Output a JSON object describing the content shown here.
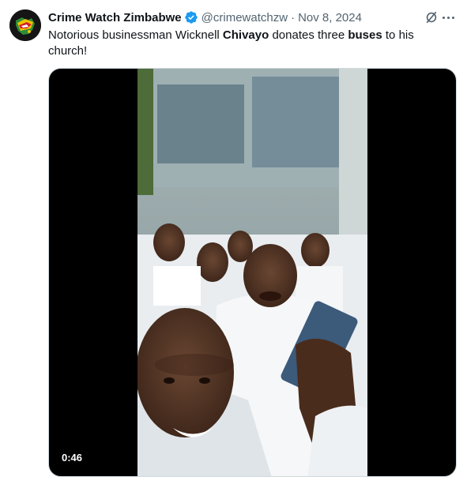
{
  "tweet": {
    "author": {
      "display_name": "Crime Watch Zimbabwe",
      "handle": "@crimewatchzw",
      "verified": true
    },
    "separator": "·",
    "timestamp": "Nov 8, 2024",
    "text_parts": [
      "Notorious businessman Wicknell ",
      "Chivayo",
      " donates three ",
      "buses",
      " to his church!"
    ],
    "media": {
      "type": "video",
      "duration": "0:46"
    },
    "icons": {
      "verified": "verified-badge-icon",
      "grok": "grok-icon",
      "more": "more-icon"
    },
    "colors": {
      "verified": "#1d9bf0",
      "secondary_text": "#536471"
    }
  }
}
